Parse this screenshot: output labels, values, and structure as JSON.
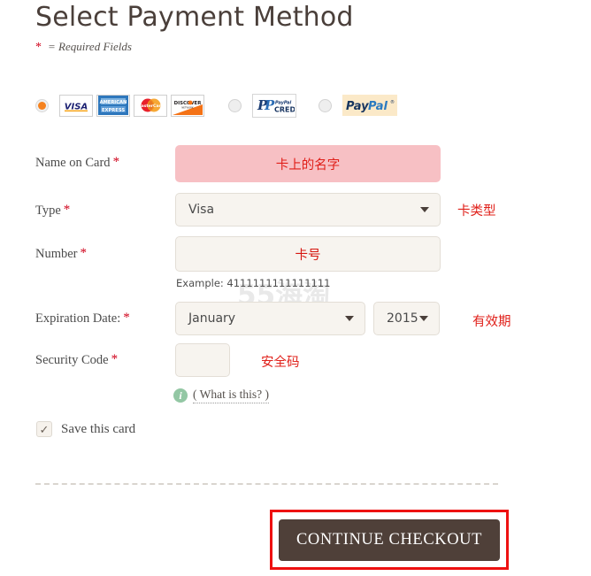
{
  "header": {
    "title": "Select Payment Method",
    "required_star": "*",
    "required_note": "= Required Fields"
  },
  "watermark": "55海淘",
  "payment_methods": [
    {
      "id": "credit-card",
      "selected": true,
      "logos": [
        "visa",
        "american-express",
        "mastercard",
        "discover"
      ]
    },
    {
      "id": "paypal-credit",
      "selected": false,
      "label_top": "PayPal",
      "label_bottom": "CREDIT"
    },
    {
      "id": "paypal",
      "selected": false,
      "label": "PayPal"
    }
  ],
  "form": {
    "name_on_card": {
      "label": "Name on Card",
      "star": "*",
      "value": "",
      "annotation_inside": "卡上的名字"
    },
    "type": {
      "label": "Type",
      "star": "*",
      "selected": "Visa",
      "options": [
        "Visa"
      ],
      "annotation": "卡类型"
    },
    "number": {
      "label": "Number",
      "star": "*",
      "value": "",
      "annotation_inside": "卡号",
      "example": "Example: 4111111111111111"
    },
    "expiration": {
      "label": "Expiration Date:",
      "star": "*",
      "month": "January",
      "year": "2015",
      "annotation": "有效期"
    },
    "security_code": {
      "label": "Security Code",
      "star": "*",
      "value": "",
      "annotation": "安全码",
      "help_link": "( What is this? )",
      "info_icon_glyph": "i"
    },
    "save_card": {
      "label": "Save this card",
      "checked": true,
      "check_glyph": "✓"
    }
  },
  "footer": {
    "continue_label": "CONTINUE CHECKOUT"
  },
  "colors": {
    "accent_red": "#e0201a",
    "highlight_pink": "#f7c0c4",
    "button_brown": "#4f4039",
    "radio_orange": "#f5821f",
    "outline_red": "#ee1111",
    "field_bg": "#f7f4ef"
  }
}
